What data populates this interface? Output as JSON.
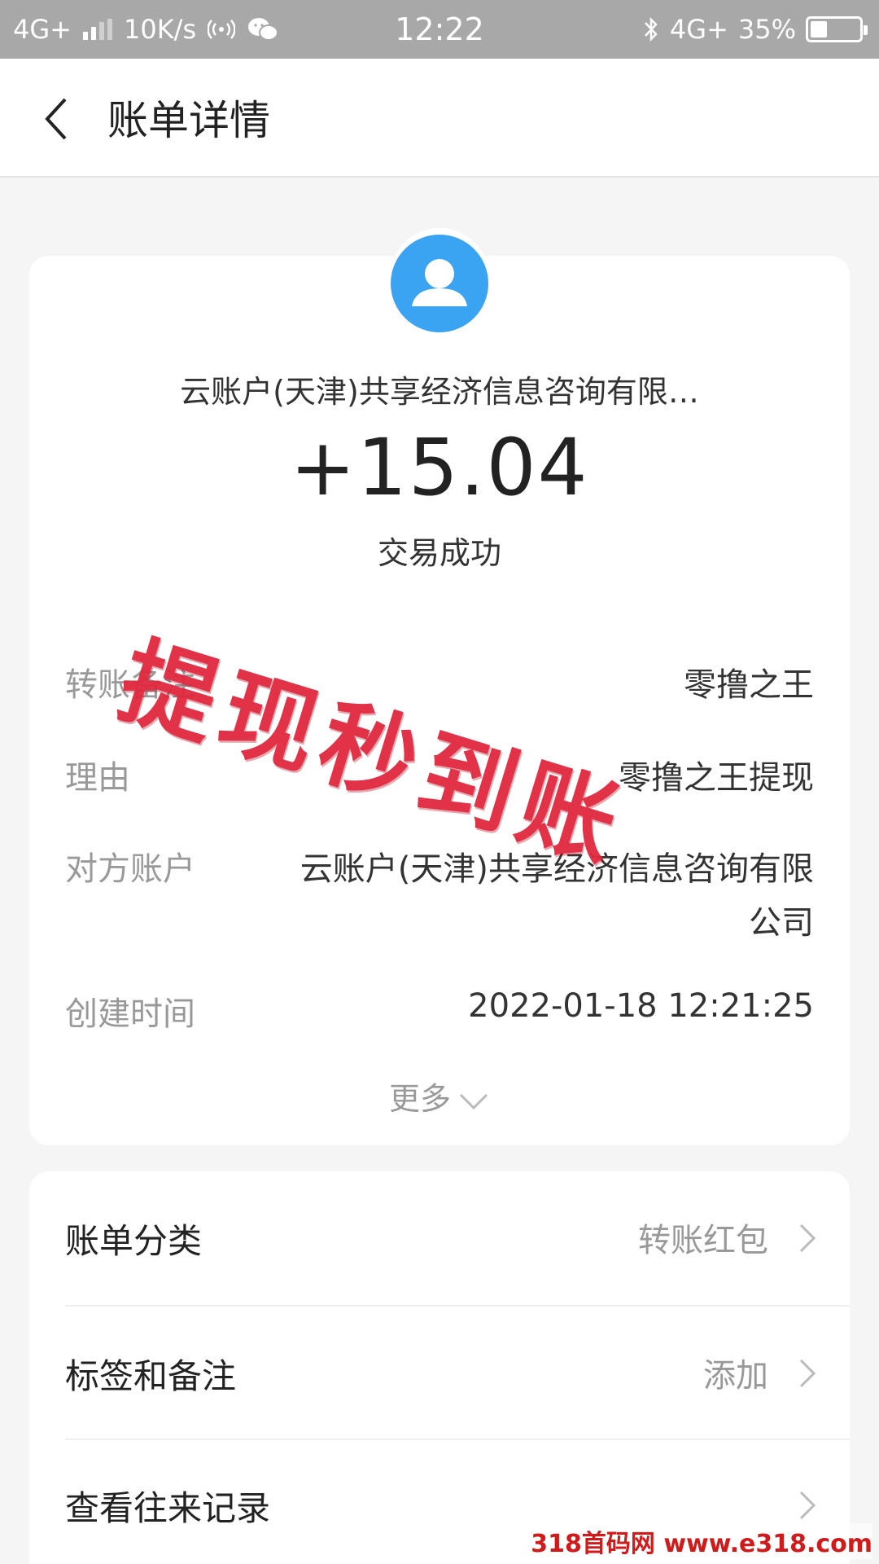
{
  "status_bar": {
    "network_left": "4G+",
    "speed": "10K/s",
    "time": "12:22",
    "network_right": "4G+",
    "battery": "35%",
    "battery_level": 0.35
  },
  "header": {
    "title": "账单详情"
  },
  "transaction": {
    "counterparty": "云账户(天津)共享经济信息咨询有限…",
    "amount": "+15.04",
    "status": "交易成功"
  },
  "details": {
    "rows": [
      {
        "label": "转账备注",
        "value": "零撸之王"
      },
      {
        "label": "理由",
        "value": "零撸之王提现"
      },
      {
        "label": "对方账户",
        "value": "云账户(天津)共享经济信息咨询有限",
        "value2": "公司"
      },
      {
        "label": "创建时间",
        "value": "2022-01-18 12:21:25"
      }
    ],
    "more_label": "更多"
  },
  "menu": {
    "items": [
      {
        "label": "账单分类",
        "value": "转账红包"
      },
      {
        "label": "标签和备注",
        "value": "添加"
      },
      {
        "label": "查看往来记录",
        "value": ""
      }
    ]
  },
  "overlay": {
    "stamp": "提现秒到账",
    "watermark": "318首码网 www.e318.com"
  },
  "colors": {
    "accent_avatar": "#3aa4f3",
    "stamp_red": "#e0283e",
    "status_bar": "#a8a8a8"
  }
}
